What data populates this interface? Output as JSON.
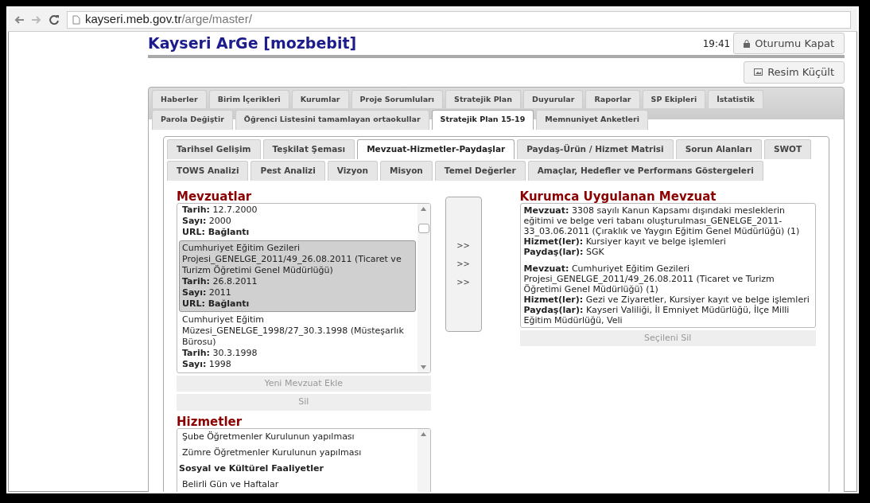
{
  "browser": {
    "url_host": "kayseri.meb.gov.tr",
    "url_path": "/arge/master/"
  },
  "header": {
    "title": "Kayseri ArGe [mozbebit]",
    "time": "19:41",
    "logout": "Oturumu Kapat",
    "shrink": "Resim Küçült"
  },
  "main_tabs": [
    {
      "label": "Haberler",
      "selected": false
    },
    {
      "label": "Birim İçerikleri",
      "selected": false
    },
    {
      "label": "Kurumlar",
      "selected": false
    },
    {
      "label": "Proje Sorumluları",
      "selected": false
    },
    {
      "label": "Stratejik Plan",
      "selected": false
    },
    {
      "label": "Duyurular",
      "selected": false
    },
    {
      "label": "Raporlar",
      "selected": false
    },
    {
      "label": "SP Ekipleri",
      "selected": false
    },
    {
      "label": "İstatistik",
      "selected": false
    },
    {
      "label": "Parola Değiştir",
      "selected": false
    },
    {
      "label": "Öğrenci Listesini tamamlayan ortaokullar",
      "selected": false
    },
    {
      "label": "Stratejik Plan 15-19",
      "selected": true
    },
    {
      "label": "Memnuniyet Anketleri",
      "selected": false
    }
  ],
  "sub_tabs": [
    {
      "label": "Tarihsel Gelişim",
      "selected": false
    },
    {
      "label": "Teşkilat Şeması",
      "selected": false
    },
    {
      "label": "Mevzuat-Hizmetler-Paydaşlar",
      "selected": true
    },
    {
      "label": "Paydaş-Ürün / Hizmet Matrisi",
      "selected": false
    },
    {
      "label": "Sorun Alanları",
      "selected": false
    },
    {
      "label": "SWOT",
      "selected": false
    },
    {
      "label": "TOWS Analizi",
      "selected": false
    },
    {
      "label": "Pest Analizi",
      "selected": false
    },
    {
      "label": "Vizyon",
      "selected": false
    },
    {
      "label": "Misyon",
      "selected": false
    },
    {
      "label": "Temel Değerler",
      "selected": false
    },
    {
      "label": "Amaçlar, Hedefler ve Performans Göstergeleri",
      "selected": false
    }
  ],
  "mevzuatlar": {
    "title": "Mevzuatlar",
    "items": [
      {
        "selected": false,
        "lines": [
          "**Tarih:** 12.7.2000",
          "**Sayı:** 2000",
          "**URL: Bağlantı**"
        ]
      },
      {
        "selected": true,
        "lines": [
          "Cumhuriyet Eğitim Gezileri Projesi_GENELGE_2011/49_26.08.2011 (Ticaret ve Turizm Öğretimi Genel Müdürlüğü)",
          "**Tarih:** 26.8.2011",
          "**Sayı:** 2011",
          "**URL: Bağlantı**"
        ]
      },
      {
        "selected": false,
        "lines": [
          "Cumhuriyet Eğitim Müzesi_GENELGE_1998/27_30.3.1998 (Müsteşarlık Bürosu)",
          "**Tarih:** 30.3.1998",
          "**Sayı:** 1998"
        ]
      }
    ],
    "add_button": "Yeni Mevzuat Ekle",
    "delete_button": "Sil"
  },
  "move_buttons": [
    ">>",
    ">>",
    ">>"
  ],
  "kurumca": {
    "title": "Kurumca Uygulanan Mevzuat",
    "entries": [
      {
        "lines": [
          "**Mevzuat:** 3308 sayılı Kanun Kapsamı dışındaki mesleklerin eğitimi ve belge veri tabanı oluşturulması_GENELGE_2011-33_03.06.2011 (Çıraklık ve Yaygın Eğitim Genel Müdürlüğü) (1)",
          "**Hizmet(ler):** Kursiyer kayıt ve belge işlemleri",
          "**Paydaş(lar):** SGK"
        ]
      },
      {
        "lines": [
          "**Mevzuat:** Cumhuriyet Eğitim Gezileri Projesi_GENELGE_2011/49_26.08.2011 (Ticaret ve Turizm Öğretimi Genel Müdürlüğü) (1)",
          "**Hizmet(ler):** Gezi ve Ziyaretler, Kursiyer kayıt ve belge işlemleri",
          "**Paydaş(lar):** Kayseri Valiliği, İl Emniyet Müdürlüğü, İlçe Milli Eğitim Müdürlüğü, Veli"
        ]
      }
    ],
    "delete_button": "Seçileni Sil"
  },
  "hizmetler": {
    "title": "Hizmetler",
    "items": [
      {
        "kind": "item",
        "label": "Şube Öğretmenler Kurulunun yapılması"
      },
      {
        "kind": "item",
        "label": "Zümre Öğretmenler Kurulunun yapılması"
      },
      {
        "kind": "heading",
        "label": "Sosyal ve Kültürel Faaliyetler"
      },
      {
        "kind": "item",
        "label": "Belirli Gün ve Haftalar"
      }
    ]
  }
}
